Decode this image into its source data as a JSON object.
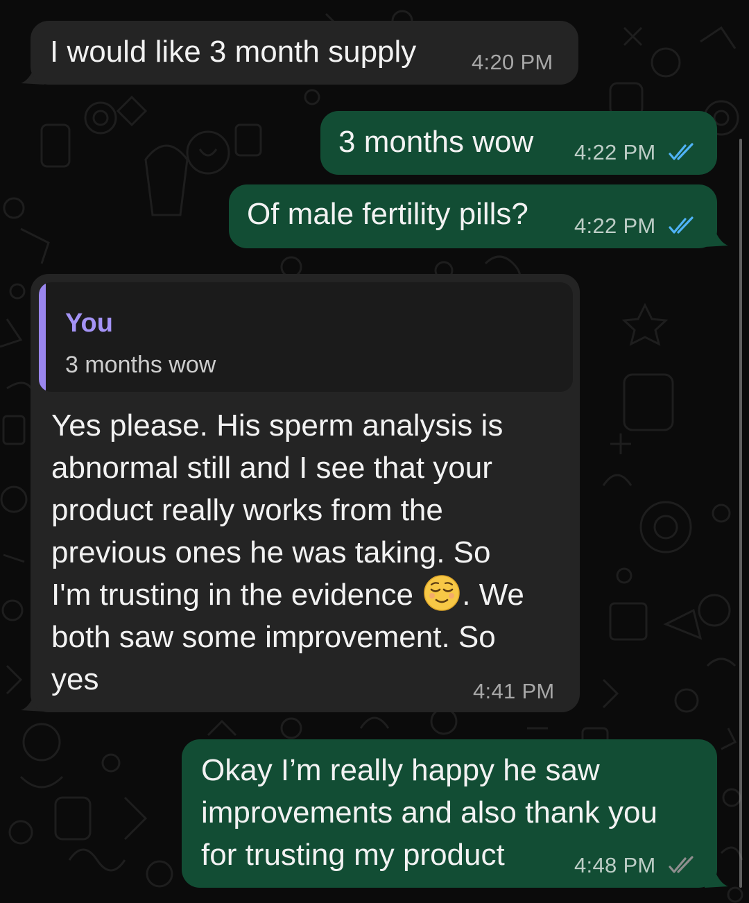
{
  "theme": {
    "incoming_bubble": "#242424",
    "outgoing_bubble": "#124d34",
    "read_tick_color": "#4fb3f6",
    "delivered_tick_color": "#8e8e8e",
    "quote_accent": "#9a86ee"
  },
  "messages": [
    {
      "direction": "incoming",
      "text": "I would like 3 month supply",
      "time": "4:20 PM"
    },
    {
      "direction": "outgoing",
      "text": "3 months wow",
      "time": "4:22 PM",
      "status": "read"
    },
    {
      "direction": "outgoing",
      "text": "Of male fertility pills?",
      "time": "4:22 PM",
      "status": "read"
    },
    {
      "direction": "incoming",
      "quote": {
        "author": "You",
        "text": "3 months wow"
      },
      "lines": [
        "Yes please. His sperm analysis is",
        "abnormal still and I see that your",
        "product really works from the",
        "previous ones he was taking. So",
        "I'm trusting in the evidence",
        ". We",
        "both saw some improvement. So",
        "yes"
      ],
      "emoji": "relieved-face",
      "time": "4:41 PM"
    },
    {
      "direction": "outgoing",
      "lines": [
        "Okay I’m really happy he saw",
        "improvements and also thank you",
        "for trusting my product"
      ],
      "time": "4:48 PM",
      "status": "delivered"
    }
  ]
}
